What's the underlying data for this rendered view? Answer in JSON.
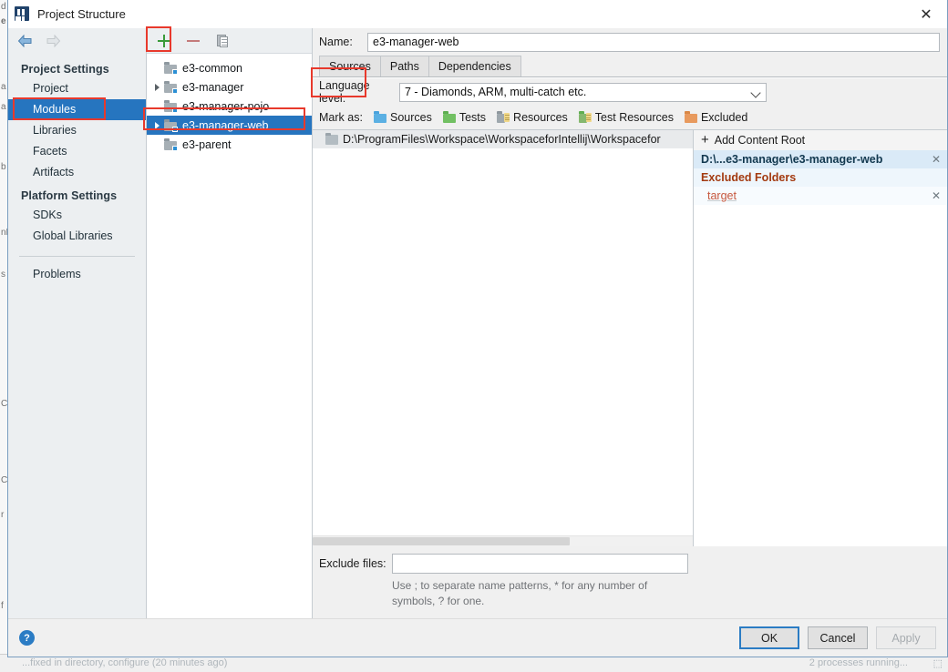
{
  "window": {
    "title": "Project Structure",
    "app_icon": "intellij-idea-icon",
    "close_label": "✕"
  },
  "nav": {
    "back_icon": "back-arrow-icon",
    "forward_icon": "forward-arrow-icon"
  },
  "sidebar": {
    "groups": [
      {
        "title": "Project Settings",
        "items": [
          {
            "label": "Project",
            "selected": false
          },
          {
            "label": "Modules",
            "selected": true
          },
          {
            "label": "Libraries",
            "selected": false
          },
          {
            "label": "Facets",
            "selected": false
          },
          {
            "label": "Artifacts",
            "selected": false
          }
        ]
      },
      {
        "title": "Platform Settings",
        "items": [
          {
            "label": "SDKs",
            "selected": false
          },
          {
            "label": "Global Libraries",
            "selected": false
          }
        ]
      }
    ],
    "extra_items": [
      {
        "label": "Problems",
        "selected": false
      }
    ]
  },
  "tree_toolbar": {
    "add_label": "+",
    "remove_label": "−",
    "copy_label": "Copy"
  },
  "module_tree": [
    {
      "label": "e3-common",
      "expandable": false,
      "selected": false
    },
    {
      "label": "e3-manager",
      "expandable": true,
      "selected": false
    },
    {
      "label": "e3-manager-pojo",
      "expandable": false,
      "selected": false
    },
    {
      "label": "e3-manager-web",
      "expandable": true,
      "selected": true
    },
    {
      "label": "e3-parent",
      "expandable": false,
      "selected": false
    }
  ],
  "detail": {
    "name_label": "Name:",
    "name_value": "e3-manager-web",
    "name_placeholder": "",
    "tabs": [
      {
        "label": "Sources",
        "active": true
      },
      {
        "label": "Paths",
        "active": false
      },
      {
        "label": "Dependencies",
        "active": false
      }
    ],
    "language_level_label": "Language level:",
    "language_level_value": "7 - Diamonds, ARM, multi-catch etc.",
    "mark_as_label": "Mark as:",
    "mark_as_options": [
      {
        "label": "Sources",
        "color": "#5bb0e3"
      },
      {
        "label": "Tests",
        "color": "#72c063"
      },
      {
        "label": "Resources",
        "color": "#9fa8ae"
      },
      {
        "label": "Test Resources",
        "color": "#85b86f"
      },
      {
        "label": "Excluded",
        "color": "#e89a5e"
      }
    ],
    "content_root_path": "D:\\ProgramFiles\\Workspace\\WorkspaceforIntellij\\Workspacefor",
    "exclude_files_label": "Exclude files:",
    "exclude_files_value": "",
    "exclude_files_placeholder": "",
    "exclude_hint": "Use ; to separate name patterns, * for any number of symbols, ? for one."
  },
  "content_roots": {
    "add_label": "Add Content Root",
    "root_entry": "D:\\...e3-manager\\e3-manager-web",
    "excluded_header": "Excluded Folders",
    "excluded_items": [
      "target"
    ],
    "remove_icon": "✕"
  },
  "footer": {
    "help_label": "?",
    "ok_label": "OK",
    "cancel_label": "Cancel",
    "apply_label": "Apply"
  },
  "background_ide": {
    "status_left": "...fixed in directory, configure (20 minutes ago)",
    "status_right": "2 processes running...",
    "status_far": "⬚"
  },
  "colors": {
    "selection_blue": "#2675bf",
    "annotation_red": "#e8392c",
    "add_green": "#3a9a3a",
    "excluded_orange": "#a33a10",
    "accent_blue": "#2b7cc4"
  }
}
